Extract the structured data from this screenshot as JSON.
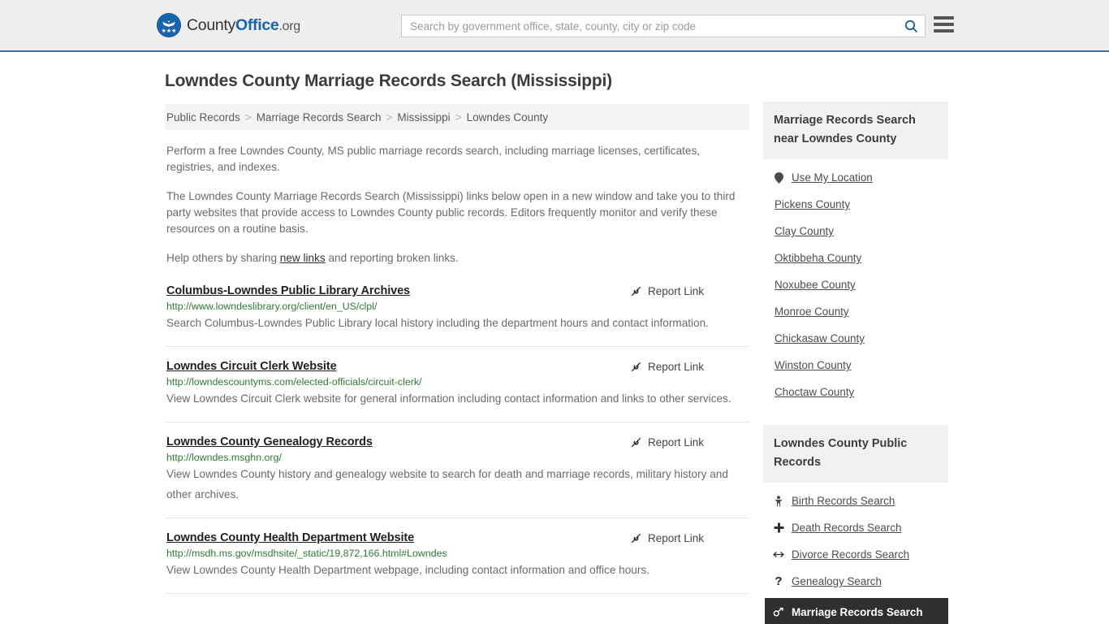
{
  "header": {
    "logo": {
      "part1": "County",
      "part2": "Office",
      "part3": ".org",
      "icon": "eagle-stars-icon"
    },
    "search": {
      "placeholder": "Search by government office, state, county, city or zip code",
      "value": ""
    },
    "search_icon": "search-icon",
    "menu_icon": "hamburger-menu-icon"
  },
  "page": {
    "title": "Lowndes County Marriage Records Search (Mississippi)"
  },
  "breadcrumb": {
    "items": [
      {
        "label": "Public Records",
        "current": false
      },
      {
        "label": "Marriage Records Search",
        "current": false
      },
      {
        "label": "Mississippi",
        "current": false
      },
      {
        "label": "Lowndes County",
        "current": true
      }
    ],
    "separator": ">"
  },
  "intro": {
    "p1": "Perform a free Lowndes County, MS public marriage records search, including marriage licenses, certificates, registries, and indexes.",
    "p2": "The Lowndes County Marriage Records Search (Mississippi) links below open in a new window and take you to third party websites that provide access to Lowndes County public records. Editors frequently monitor and verify these resources on a routine basis.",
    "p3_before": "Help others by sharing ",
    "p3_link": "new links",
    "p3_after": " and reporting broken links."
  },
  "results": {
    "report_label": "Report Link",
    "report_icon": "broken-link-icon",
    "items": [
      {
        "title": "Columbus-Lowndes Public Library Archives",
        "url": "http://www.lowndeslibrary.org/client/en_US/clpl/",
        "description": "Search Columbus-Lowndes Public Library local history including the department hours and contact information."
      },
      {
        "title": "Lowndes Circuit Clerk Website",
        "url": "http://lowndescountyms.com/elected-officials/circuit-clerk/",
        "description": "View Lowndes Circuit Clerk website for general information including contact information and links to other services."
      },
      {
        "title": "Lowndes County Genealogy Records",
        "url": "http://lowndes.msghn.org/",
        "description": "View Lowndes County history and genealogy website to search for death and marriage records, military history and other archives."
      },
      {
        "title": "Lowndes County Health Department Website",
        "url": "http://msdh.ms.gov/msdhsite/_static/19,872,166.html#Lowndes",
        "description": "View Lowndes County Health Department webpage, including contact information and office hours."
      }
    ]
  },
  "sidebar": {
    "card1": {
      "heading": "Marriage Records Search near Lowndes County",
      "location_label": "Use My Location",
      "location_icon": "map-pin-icon",
      "counties": [
        "Pickens County",
        "Clay County",
        "Oktibbeha County",
        "Noxubee County",
        "Monroe County",
        "Chickasaw County",
        "Winston County",
        "Choctaw County"
      ]
    },
    "card2": {
      "heading": "Lowndes County Public Records",
      "links": [
        {
          "label": "Birth Records Search",
          "icon": "baby-icon",
          "glyph": "๏",
          "highlight": false
        },
        {
          "label": "Death Records Search",
          "icon": "cross-icon",
          "glyph": "✚",
          "highlight": false
        },
        {
          "label": "Divorce Records Search",
          "icon": "left-right-arrow-icon",
          "glyph": "↔",
          "highlight": false
        },
        {
          "label": "Genealogy Search",
          "icon": "question-mark-icon",
          "glyph": "?",
          "highlight": false
        },
        {
          "label": "Marriage Records Search",
          "icon": "venus-mars-icon",
          "glyph": "⚥",
          "highlight": true
        }
      ]
    }
  },
  "colors": {
    "brand_blue": "#1a64ab",
    "header_bg": "#eeeeee",
    "link_green": "#2d7a34",
    "highlight_bg": "#2f2f2f"
  }
}
